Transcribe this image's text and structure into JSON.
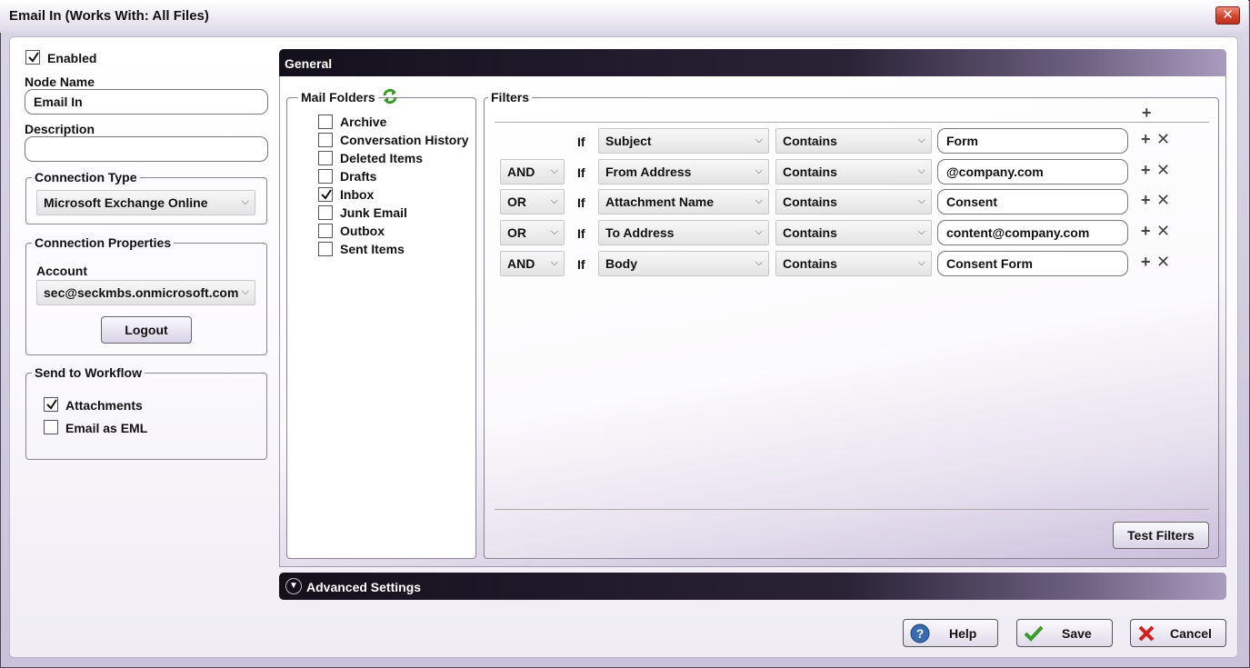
{
  "window": {
    "title": "Email In (Works With: All Files)"
  },
  "left": {
    "enabled_label": "Enabled",
    "enabled_checked": true,
    "node_name_label": "Node Name",
    "node_name_value": "Email In",
    "description_label": "Description",
    "description_value": "",
    "connection_type": {
      "legend": "Connection Type",
      "value": "Microsoft Exchange Online"
    },
    "connection_properties": {
      "legend": "Connection Properties",
      "account_label": "Account",
      "account_value": "sec@seckmbs.onmicrosoft.com",
      "logout_label": "Logout"
    },
    "send_to_workflow": {
      "legend": "Send to Workflow",
      "items": [
        {
          "label": "Attachments",
          "checked": true
        },
        {
          "label": "Email as EML",
          "checked": false
        }
      ]
    }
  },
  "general": {
    "title": "General",
    "mail_folders": {
      "legend": "Mail Folders",
      "items": [
        {
          "label": "Archive",
          "checked": false
        },
        {
          "label": "Conversation History",
          "checked": false
        },
        {
          "label": "Deleted Items",
          "checked": false
        },
        {
          "label": "Drafts",
          "checked": false
        },
        {
          "label": "Inbox",
          "checked": true
        },
        {
          "label": "Junk Email",
          "checked": false
        },
        {
          "label": "Outbox",
          "checked": false
        },
        {
          "label": "Sent Items",
          "checked": false
        }
      ]
    },
    "filters": {
      "legend": "Filters",
      "if_label": "If",
      "rows": [
        {
          "logic": "",
          "field": "Subject",
          "operator": "Contains",
          "value": "Form"
        },
        {
          "logic": "AND",
          "field": "From Address",
          "operator": "Contains",
          "value": "@company.com"
        },
        {
          "logic": "OR",
          "field": "Attachment Name",
          "operator": "Contains",
          "value": "Consent"
        },
        {
          "logic": "OR",
          "field": "To Address",
          "operator": "Contains",
          "value": "content@company.com"
        },
        {
          "logic": "AND",
          "field": "Body",
          "operator": "Contains",
          "value": "Consent Form"
        }
      ],
      "test_button": "Test Filters"
    }
  },
  "advanced": {
    "title": "Advanced Settings"
  },
  "footer": {
    "help": "Help",
    "save": "Save",
    "cancel": "Cancel"
  }
}
